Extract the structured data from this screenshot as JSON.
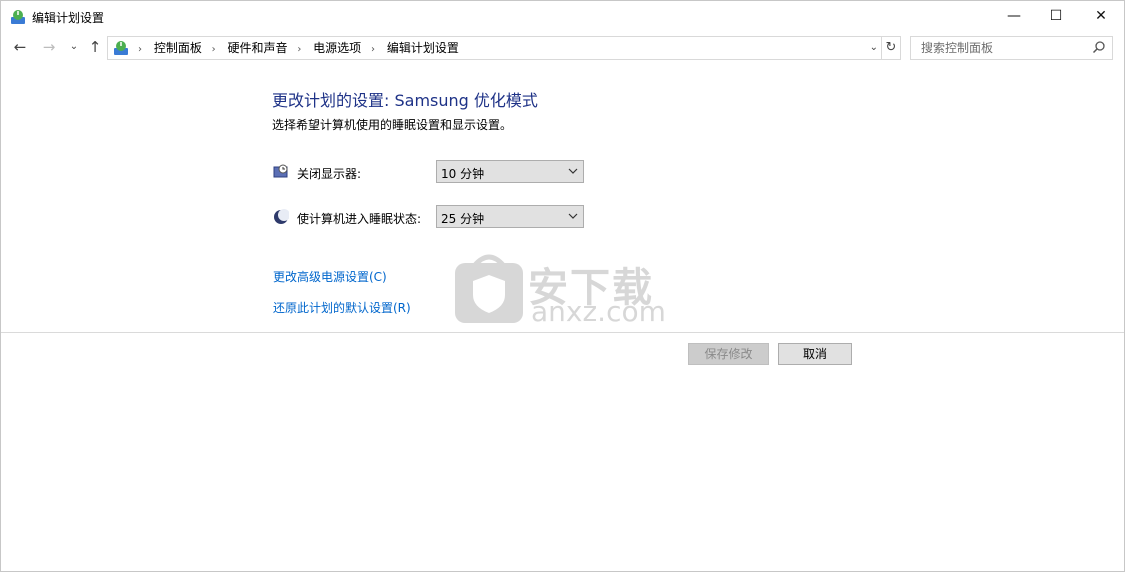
{
  "window": {
    "title": "编辑计划设置",
    "controls": {
      "minimize": "—",
      "maximize": "☐",
      "close": "✕"
    }
  },
  "nav": {
    "back": "←",
    "forward": "→",
    "recent": "⌄",
    "up": "↑",
    "breadcrumbs": [
      "控制面板",
      "硬件和声音",
      "电源选项",
      "编辑计划设置"
    ],
    "separator": "›",
    "address_dropdown": "⌄",
    "refresh": "↻",
    "search_placeholder": "搜索控制面板"
  },
  "main": {
    "heading": "更改计划的设置: Samsung 优化模式",
    "subtitle": "选择希望计算机使用的睡眠设置和显示设置。",
    "settings": [
      {
        "label": "关闭显示器:",
        "value": "10 分钟",
        "icon": "monitor-clock-icon"
      },
      {
        "label": "使计算机进入睡眠状态:",
        "value": "25 分钟",
        "icon": "moon-icon"
      }
    ],
    "links": {
      "advanced": "更改高级电源设置(C)",
      "restore": "还原此计划的默认设置(R)"
    },
    "buttons": {
      "save": "保存修改",
      "cancel": "取消"
    }
  },
  "watermark": {
    "brand": "安下载",
    "domain": "anxz.com"
  },
  "colors": {
    "heading": "#1e3287",
    "link": "#0066cc",
    "button_bg": "#e1e1e1"
  }
}
